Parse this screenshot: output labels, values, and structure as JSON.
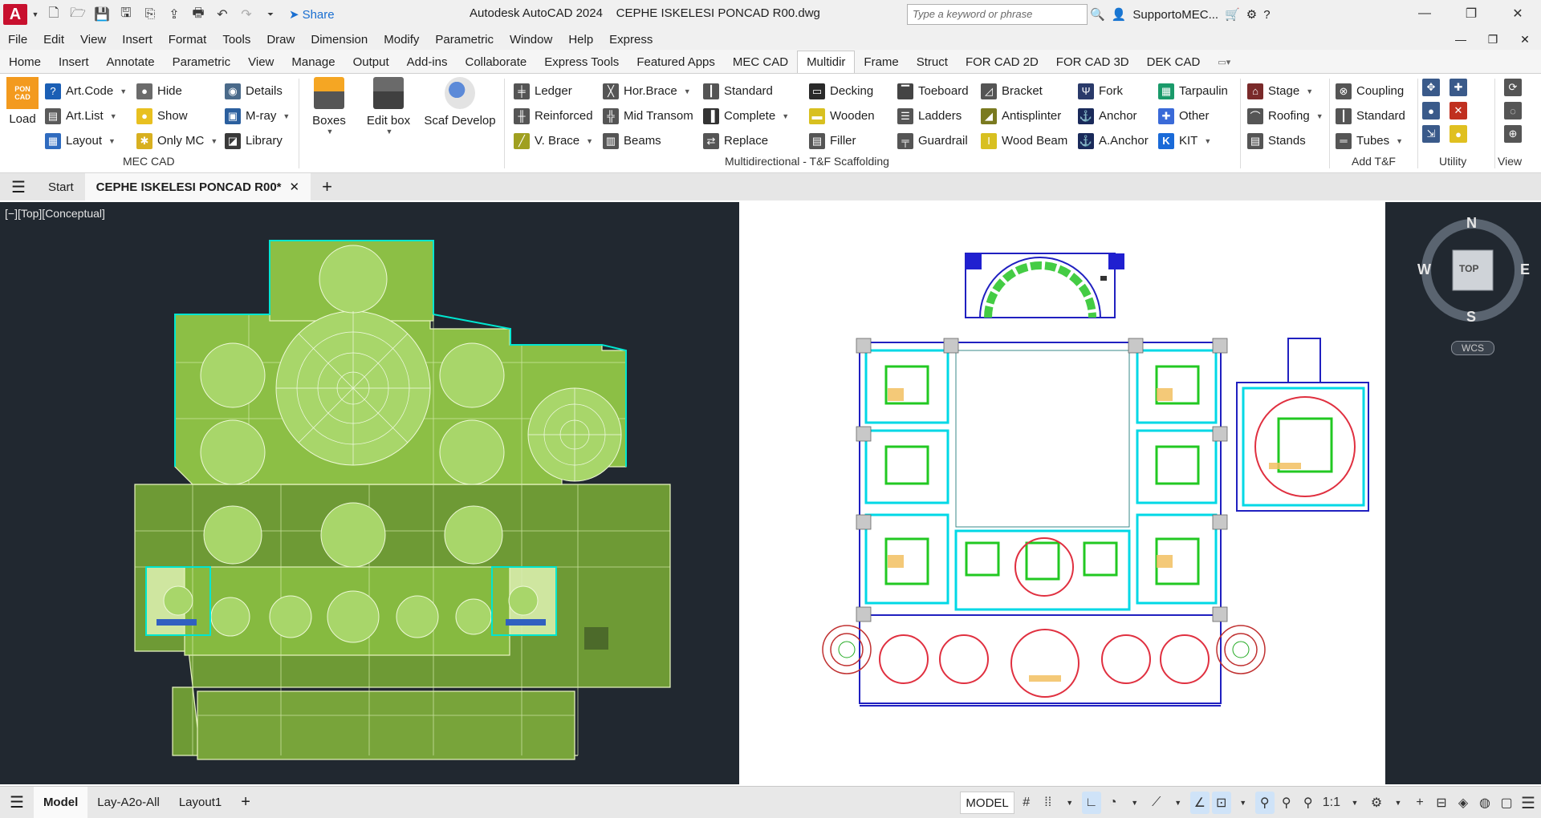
{
  "app": {
    "logo": "A",
    "title": "Autodesk AutoCAD 2024    CEPHE ISKELESI PONCAD R00.dwg",
    "share": "Share",
    "search_placeholder": "Type a keyword or phrase",
    "user": "SupportoMEC..."
  },
  "menu": [
    "File",
    "Edit",
    "View",
    "Insert",
    "Format",
    "Tools",
    "Draw",
    "Dimension",
    "Modify",
    "Parametric",
    "Window",
    "Help",
    "Express"
  ],
  "ribbon_tabs": [
    "Home",
    "Insert",
    "Annotate",
    "Parametric",
    "View",
    "Manage",
    "Output",
    "Add-ins",
    "Collaborate",
    "Express Tools",
    "Featured Apps",
    "MEC CAD",
    "Multidir",
    "Frame",
    "Struct",
    "FOR CAD 2D",
    "FOR CAD 3D",
    "DEK CAD"
  ],
  "active_tab": "Multidir",
  "ribbon": {
    "load": "Load",
    "poncad_logo": "PON CAD",
    "mec_col1": [
      "Art.Code",
      "Art.List",
      "Layout"
    ],
    "mec_col2": [
      "Hide",
      "Show",
      "Only MC"
    ],
    "mec_col3": [
      "Details",
      "M-ray",
      "Library"
    ],
    "boxes": "Boxes",
    "editbox": "Edit box",
    "scaf": "Scaf Develop",
    "md_col1": [
      "Ledger",
      "Reinforced",
      "V. Brace"
    ],
    "md_col2": [
      "Hor.Brace",
      "Mid Transom",
      "Beams"
    ],
    "md_col3": [
      "Standard",
      "Complete",
      "Replace"
    ],
    "md_col4": [
      "Decking",
      "Wooden",
      "Filler"
    ],
    "md_col5": [
      "Toeboard",
      "Ladders",
      "Guardrail"
    ],
    "md_col6": [
      "Bracket",
      "Antisplinter",
      "Wood Beam"
    ],
    "md_col7": [
      "Fork",
      "Anchor",
      "A.Anchor"
    ],
    "md_col8": [
      "Tarpaulin",
      "Other",
      "KIT"
    ],
    "md_col9": [
      "Stage",
      "Roofing",
      "Stands"
    ],
    "add_col": [
      "Coupling",
      "Standard",
      "Tubes"
    ],
    "panel_mec": "MEC CAD",
    "panel_md": "Multidirectional - T&F Scaffolding",
    "panel_add": "Add T&F",
    "panel_util": "Utility",
    "panel_view": "View"
  },
  "doc_tabs": {
    "start": "Start",
    "active": "CEPHE ISKELESI PONCAD R00*"
  },
  "viewport": {
    "label": "[−][Top][Conceptual]"
  },
  "viewcube": {
    "n": "N",
    "s": "S",
    "e": "E",
    "w": "W",
    "face": "TOP",
    "wcs": "WCS"
  },
  "status": {
    "tabs": [
      "Model",
      "Lay-A2o-All",
      "Layout1"
    ],
    "mode": "MODEL",
    "scale": "1:1"
  },
  "colors": {
    "green_fill": "#8db844",
    "cyan": "#00e6e6",
    "blue": "#3030c8",
    "red": "#e03040",
    "viewport_bg": "#212830"
  }
}
